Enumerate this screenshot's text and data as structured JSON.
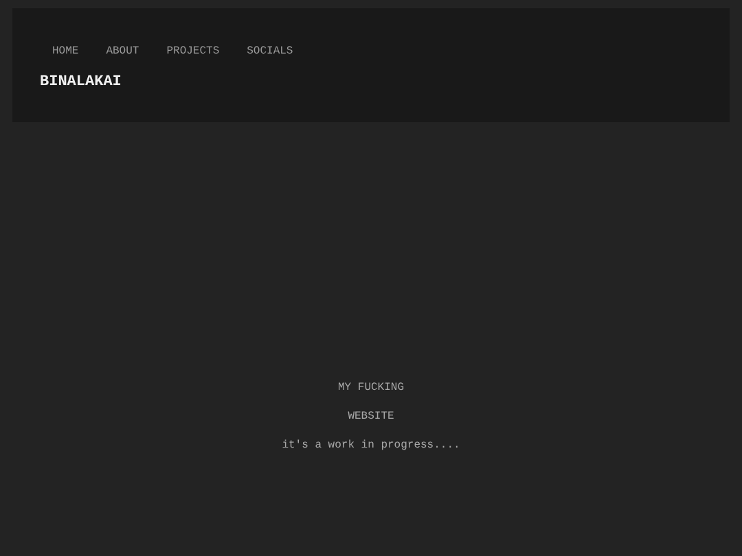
{
  "nav": {
    "items": [
      "HOME",
      "ABOUT",
      "PROJECTS",
      "SOCIALS"
    ]
  },
  "logo": "BINALAKAI",
  "main": {
    "lines": [
      "MY FUCKING",
      "WEBSITE"
    ],
    "tagline": "it's a work in progress...."
  }
}
